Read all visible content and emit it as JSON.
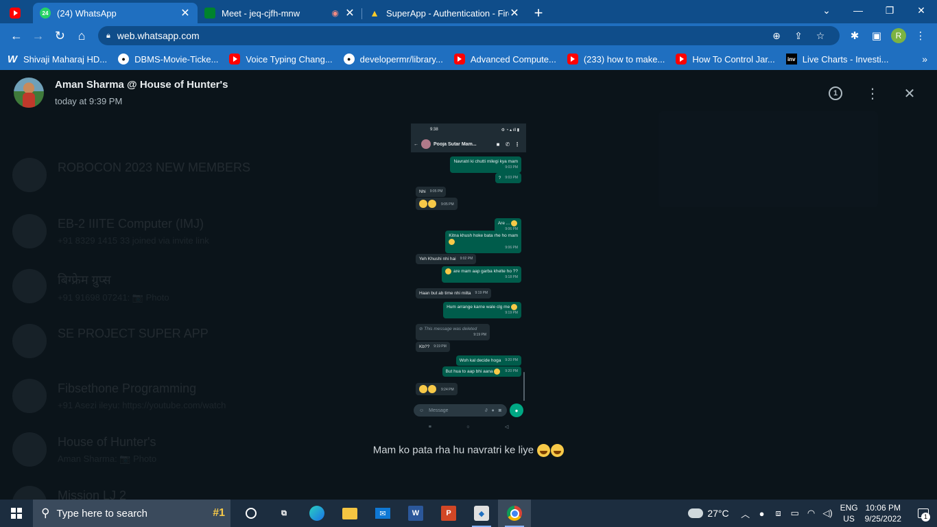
{
  "browser": {
    "tabs": [
      {
        "title": "",
        "icon": "youtube-icon"
      },
      {
        "title": "(24) WhatsApp",
        "icon": "whatsapp-icon",
        "badge": "24",
        "active": true
      },
      {
        "title": "Meet - jeq-cjfh-mnw",
        "icon": "google-meet-icon",
        "recording": true
      },
      {
        "title": "SuperApp - Authentication - Fire",
        "icon": "firebase-icon"
      }
    ],
    "url": "web.whatsapp.com",
    "profile_initial": "R",
    "bookmarks": [
      {
        "label": "Shivaji Maharaj HD...",
        "icon": "wallpaper-icon"
      },
      {
        "label": "DBMS-Movie-Ticke...",
        "icon": "github-icon"
      },
      {
        "label": "Voice Typing Chang...",
        "icon": "youtube-icon"
      },
      {
        "label": "developermr/library...",
        "icon": "github-icon"
      },
      {
        "label": "Advanced Compute...",
        "icon": "youtube-icon"
      },
      {
        "label": "(233) how to make...",
        "icon": "youtube-icon"
      },
      {
        "label": "How To Control Jar...",
        "icon": "youtube-icon"
      },
      {
        "label": "Live Charts - Investi...",
        "icon": "investing-icon"
      }
    ]
  },
  "viewer": {
    "sender": "Aman Sharma @ House of Hunter's",
    "timestamp": "today at 9:39 PM",
    "timer_label": "1",
    "caption": "Mam ko pata rha hu navratri ke liye"
  },
  "phone": {
    "status_time": "9:38",
    "contact": "Pooja Sutar Mam...",
    "messages": [
      {
        "dir": "out",
        "text": "Navratri ki chutti milegi kya mam",
        "time": "9:03 PM"
      },
      {
        "dir": "out",
        "text": "?",
        "time": "9:03 PM"
      },
      {
        "dir": "in",
        "text": "Nhi",
        "time": "9:05 PM"
      },
      {
        "dir": "in",
        "text": "",
        "time": "9:05 PM"
      },
      {
        "dir": "out",
        "text": "Are ...",
        "time": "9:06 PM"
      },
      {
        "dir": "out",
        "text": "Kitna khush hoke bata rhe ho mam",
        "time": "9:06 PM"
      },
      {
        "dir": "in",
        "text": "Yeh Khushi nhi hai",
        "time": "9:02 PM"
      },
      {
        "dir": "out",
        "text": "are mam aap garba khelte ho ??",
        "time": "9:18 PM"
      },
      {
        "dir": "in",
        "text": "Haan but ab time nhi milta",
        "time": "9:19 PM"
      },
      {
        "dir": "out",
        "text": "Hum arrange karne wale clg me",
        "time": "9:19 PM"
      },
      {
        "dir": "in",
        "text": "This message was deleted",
        "time": "9:19 PM",
        "deleted": true
      },
      {
        "dir": "in",
        "text": "Kb??",
        "time": "9:19 PM"
      },
      {
        "dir": "out",
        "text": "Woh kal decide hoga",
        "time": "9:20 PM"
      },
      {
        "dir": "out",
        "text": "But hua to aap bhi aana",
        "time": "9:20 PM"
      },
      {
        "dir": "in",
        "text": "",
        "time": "9:24 PM"
      }
    ],
    "input_placeholder": "Message"
  },
  "taskbar": {
    "search_placeholder": "Type here to search",
    "search_promo": "#1",
    "weather": "27°C",
    "lang_1": "ENG",
    "lang_2": "US",
    "time": "10:06 PM",
    "date": "9/25/2022",
    "notifications": "1"
  },
  "background_chats": [
    {
      "name": "ROBOCON 2023 NEW MEMBERS",
      "preview": ""
    },
    {
      "name": "EB-2 IIITE Computer (IMJ)",
      "preview": "+91 8329 1415 33 joined via invite link"
    },
    {
      "name": "बिग्फ्रेम ग्रुप्स",
      "preview": "+91 91698 07241: 📷 Photo"
    },
    {
      "name": "SE PROJECT SUPER APP",
      "preview": ""
    },
    {
      "name": "Fibsethone Programming",
      "preview": "+91 Asezi ileyu: https://youtube.com/watch"
    },
    {
      "name": "House of Hunter's",
      "preview": "Aman Sharma: 📷 Photo"
    },
    {
      "name": "Mission LJ 2",
      "preview": ""
    }
  ]
}
